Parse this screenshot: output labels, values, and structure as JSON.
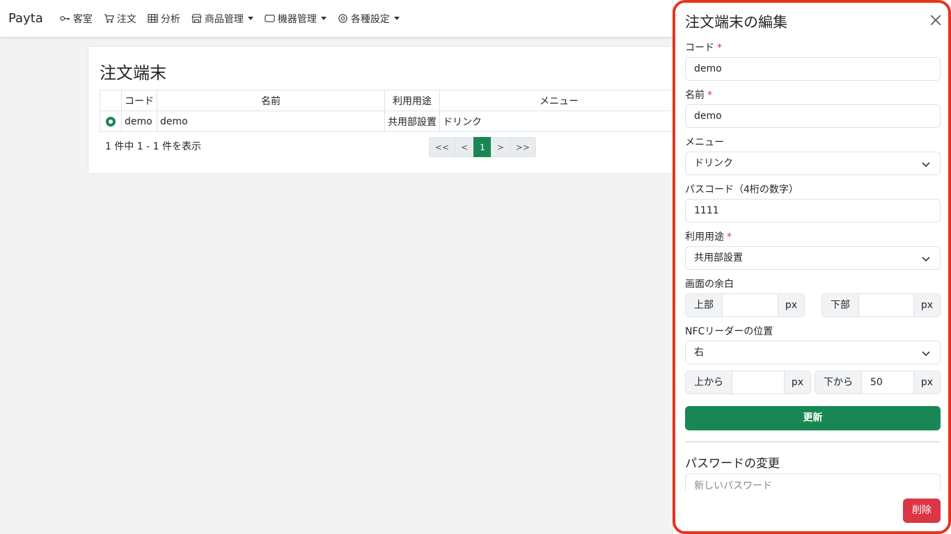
{
  "navbar": {
    "brand": "Payta",
    "items": [
      {
        "label": "客室",
        "icon": "key-icon"
      },
      {
        "label": "注文",
        "icon": "cart-icon"
      },
      {
        "label": "分析",
        "icon": "table-icon"
      },
      {
        "label": "商品管理",
        "icon": "shop-icon"
      },
      {
        "label": "機器管理",
        "icon": "tablet-icon"
      },
      {
        "label": "各種設定",
        "icon": "gear-icon"
      }
    ]
  },
  "main": {
    "title": "注文端末",
    "table": {
      "headers": [
        "",
        "コード",
        "名前",
        "利用用途",
        "メニュー"
      ],
      "rows": [
        {
          "code": "demo",
          "name": "demo",
          "usage": "共用部設置",
          "menu": "ドリンク"
        }
      ]
    },
    "summary": "1 件中 1 - 1 件を表示",
    "pager": [
      "<<",
      "<",
      "1",
      ">",
      ">>"
    ]
  },
  "panel": {
    "title": "注文端末の編集",
    "code_label": "コード",
    "code_value": "demo",
    "name_label": "名前",
    "name_value": "demo",
    "menu_label": "メニュー",
    "menu_value": "ドリンク",
    "passcode_label": "パスコード（4桁の数字）",
    "passcode_value": "1111",
    "usage_label": "利用用途",
    "usage_value": "共用部設置",
    "margin_label": "画面の余白",
    "margin_top_label": "上部",
    "margin_bottom_label": "下部",
    "unit": "px",
    "nfc_label": "NFCリーダーの位置",
    "nfc_value": "右",
    "from_top_label": "上から",
    "from_bottom_label": "下から",
    "from_bottom_value": "50",
    "required_mark": "*",
    "update_button": "更新",
    "password_title": "パスワードの変更",
    "new_password_placeholder": "新しいパスワード",
    "delete_button": "削除"
  },
  "colors": {
    "accent": "#198754",
    "danger": "#dc3545",
    "highlight": "#e8331d"
  }
}
